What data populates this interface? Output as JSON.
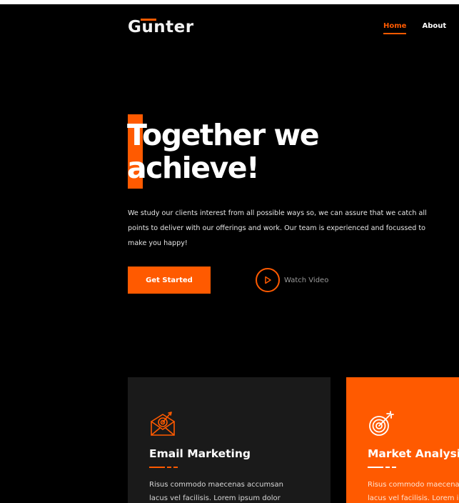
{
  "brand": {
    "logo_text": "Gunter",
    "accent_color": "#ff5a00"
  },
  "nav": {
    "items": [
      {
        "label": "Home",
        "active": true
      },
      {
        "label": "About",
        "active": false
      }
    ]
  },
  "hero": {
    "title_line1": "Together we",
    "title_line2": "achieve!",
    "description": "We study our clients interest from all possible ways so, we can assure that we catch all points to deliver with our offerings and work. Our team is experienced and focussed to make you happy!",
    "primary_button": "Get Started",
    "secondary_button": "Watch Video",
    "secondary_icon": "play-icon"
  },
  "services": [
    {
      "title": "Email Marketing",
      "icon": "email-target-icon",
      "text_line1": "Risus commodo maecenas accumsan",
      "text_line2": "lacus vel facilisis. Lorem ipsum dolor",
      "background": "#1a1a1a"
    },
    {
      "title": "Market Analysis",
      "icon": "target-icon",
      "text_line1": "Risus commodo maecenas accumsan",
      "text_line2": "lacus vel facilisis. Lorem ipsum dolor",
      "background": "#ff5a00"
    }
  ]
}
